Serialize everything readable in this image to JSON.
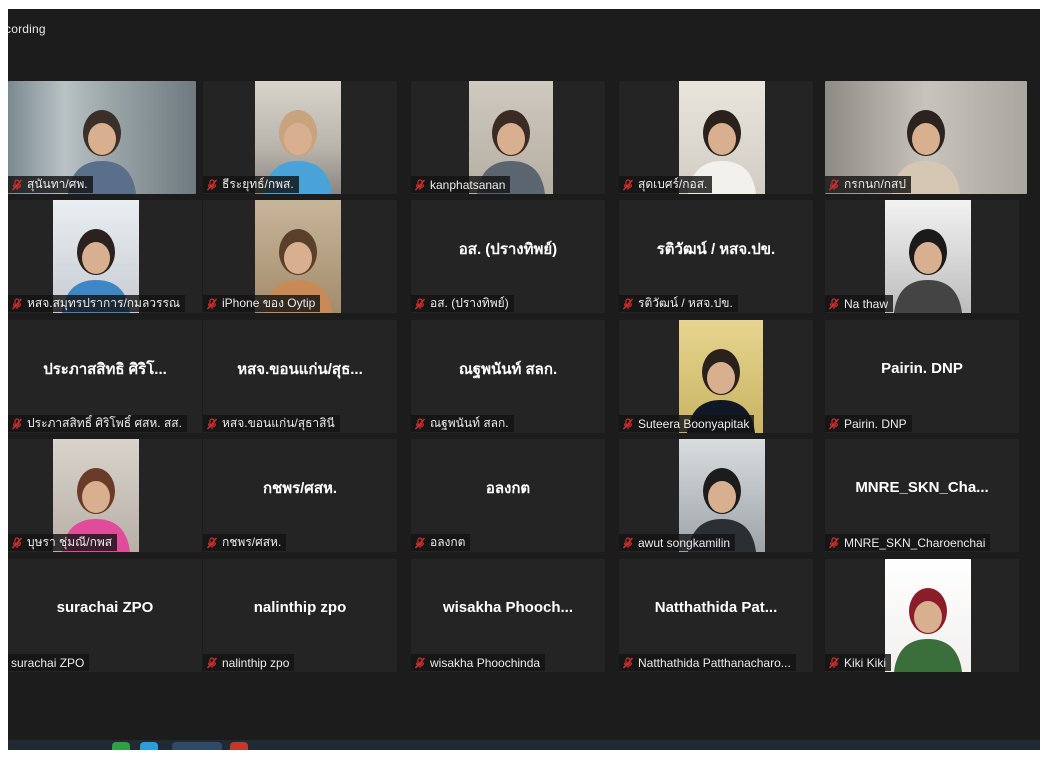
{
  "topbar": {
    "recording_label": "cording"
  },
  "colors": {
    "background": "#1c1c1c",
    "tile": "#242424",
    "mute_icon": "#d32f2f",
    "text": "#ececec"
  },
  "participants": [
    {
      "name": "สุนันทา/ศพ.",
      "display": "",
      "video": true,
      "muted": true
    },
    {
      "name": "ธีระยุทธ์/กพส.",
      "display": "",
      "video": true,
      "muted": true
    },
    {
      "name": "kanphatsanan",
      "display": "",
      "video": true,
      "muted": true
    },
    {
      "name": "สุดเบศร์/กอส.",
      "display": "",
      "video": true,
      "muted": true
    },
    {
      "name": "กรกนก/กสป",
      "display": "",
      "video": true,
      "muted": true
    },
    {
      "name": "หสจ.สมุทรปราการ/กมลวรรณ",
      "display": "",
      "video": true,
      "muted": true
    },
    {
      "name": "iPhone ของ Oytip",
      "display": "",
      "video": true,
      "muted": true
    },
    {
      "name": "อส. (ปรางทิพย์)",
      "display": "อส. (ปรางทิพย์)",
      "video": false,
      "muted": true
    },
    {
      "name": "รติวัฒน์ / หสจ.ปข.",
      "display": "รติวัฒน์ / หสจ.ปข.",
      "video": false,
      "muted": true
    },
    {
      "name": "Na thaw",
      "display": "",
      "video": true,
      "muted": true
    },
    {
      "name": "ประภาสสิทธิ์ ศิริโพธิ์ ศสห. สส.",
      "display": "ประภาสสิทธิ ศิริโ...",
      "video": false,
      "muted": true
    },
    {
      "name": "หสจ.ขอนแก่น/สุธาสินี",
      "display": "หสจ.ขอนแก่น/สุธ...",
      "video": false,
      "muted": true
    },
    {
      "name": "ณฐพนันท์ สลก.",
      "display": "ณฐพนันท์ สลก.",
      "video": false,
      "muted": true
    },
    {
      "name": "Suteera Boonyapitak",
      "display": "",
      "video": true,
      "muted": true
    },
    {
      "name": "Pairin. DNP",
      "display": "Pairin. DNP",
      "video": false,
      "muted": true
    },
    {
      "name": "บุษรา ชุ่มณี/กพส",
      "display": "",
      "video": true,
      "muted": true
    },
    {
      "name": "กชพร/ศสห.",
      "display": "กชพร/ศสห.",
      "video": false,
      "muted": true
    },
    {
      "name": "อลงกต",
      "display": "อลงกต",
      "video": false,
      "muted": true
    },
    {
      "name": "awut songkamilin",
      "display": "",
      "video": true,
      "muted": true
    },
    {
      "name": "MNRE_SKN_Charoenchai",
      "display": "MNRE_SKN_Cha...",
      "video": false,
      "muted": true
    },
    {
      "name": "surachai ZPO",
      "display": "surachai ZPO",
      "video": false,
      "muted": false
    },
    {
      "name": "nalinthip zpo",
      "display": "nalinthip zpo",
      "video": false,
      "muted": true
    },
    {
      "name": "wisakha Phoochinda",
      "display": "wisakha  Phooch...",
      "video": false,
      "muted": true
    },
    {
      "name": "Natthathida Patthanacharo...",
      "display": "Natthathida  Pat...",
      "video": false,
      "muted": true
    },
    {
      "name": "Kiki Kiki",
      "display": "",
      "video": true,
      "muted": true
    }
  ]
}
